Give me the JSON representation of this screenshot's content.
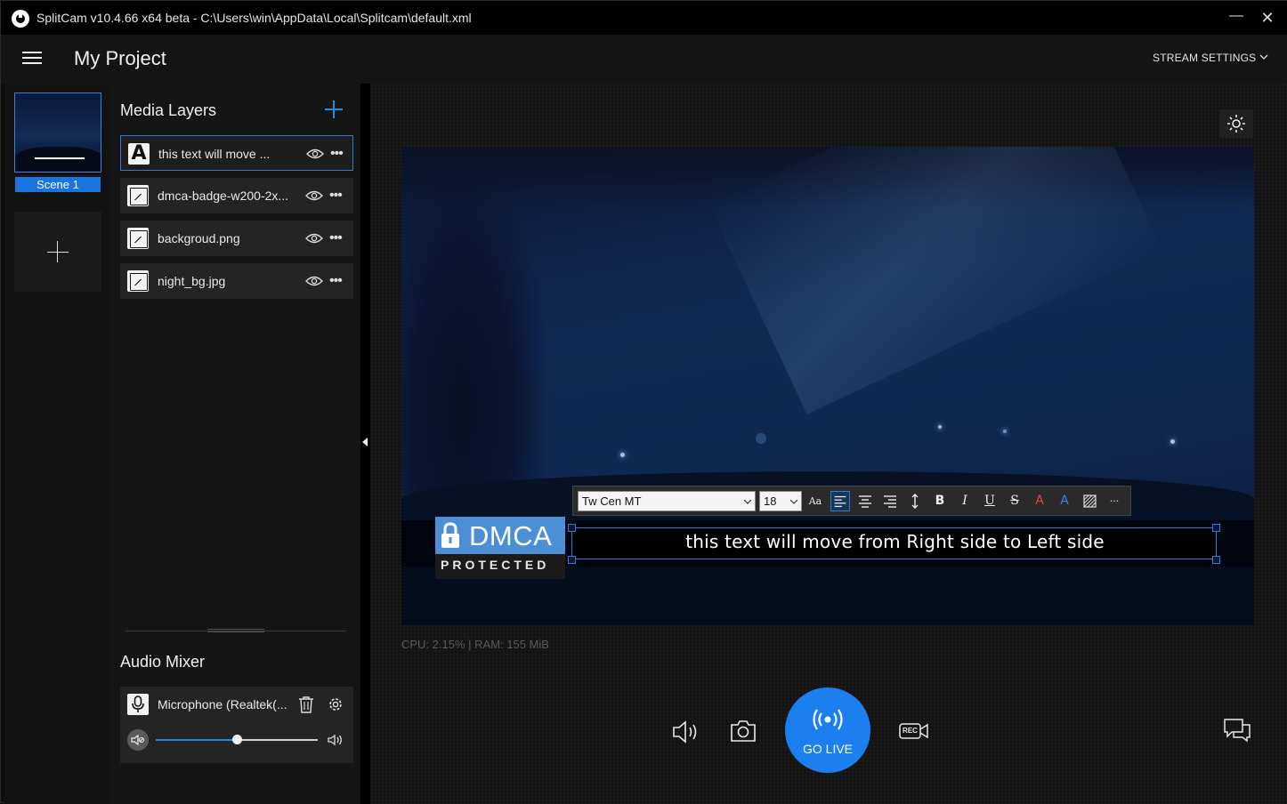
{
  "window": {
    "title": "SplitCam v10.4.66 x64 beta - C:\\Users\\win\\AppData\\Local\\Splitcam\\default.xml",
    "minimize_glyph": "—",
    "close_glyph": "✕"
  },
  "header": {
    "project_title": "My Project",
    "stream_settings_label": "STREAM SETTINGS"
  },
  "scenes": {
    "items": [
      {
        "label": "Scene 1"
      }
    ]
  },
  "media_layers": {
    "title": "Media Layers",
    "items": [
      {
        "label": "this text will move ...",
        "type": "text"
      },
      {
        "label": "dmca-badge-w200-2x...",
        "type": "image"
      },
      {
        "label": "backgroud.png",
        "type": "image"
      },
      {
        "label": "night_bg.jpg",
        "type": "image"
      }
    ]
  },
  "audio_mixer": {
    "title": "Audio Mixer",
    "source_label": "Microphone  (Realtek(...",
    "volume_fraction": 0.5
  },
  "preview": {
    "dmca_word": "DMCA",
    "dmca_sub": "PROTECTED",
    "moving_text": "this text will move from Right side to Left side",
    "toolbar": {
      "font_family": "Tw Cen MT",
      "font_size": "18",
      "case_glyph": "Aa",
      "bold": "B",
      "italic": "I",
      "underline": "U",
      "strike": "S",
      "color_glyph": "A",
      "outline_glyph": "A",
      "more_glyph": "···"
    }
  },
  "status": {
    "stats": "CPU: 2.15% | RAM: 155 MiB"
  },
  "controls": {
    "go_live_label": "GO LIVE",
    "rec_label": "REC"
  },
  "colors": {
    "accent": "#1b7ff0",
    "selection": "#2f7bd6",
    "dmca_blue": "#4d8fd6",
    "text_red": "#e04a3a"
  }
}
